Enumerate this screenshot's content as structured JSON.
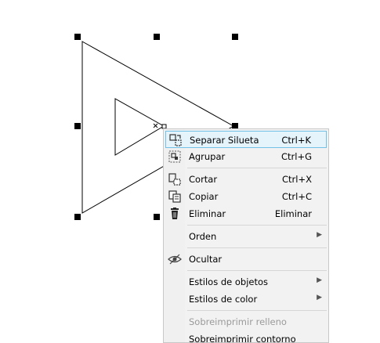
{
  "context_menu": {
    "items": [
      {
        "label": "Separar Silueta",
        "shortcut": "Ctrl+K"
      },
      {
        "label": "Agrupar",
        "shortcut": "Ctrl+G"
      },
      {
        "label": "Cortar",
        "shortcut": "Ctrl+X"
      },
      {
        "label": "Copiar",
        "shortcut": "Ctrl+C"
      },
      {
        "label": "Eliminar",
        "shortcut": "Eliminar"
      },
      {
        "label": "Orden",
        "submenu_arrow": "▶"
      },
      {
        "label": "Ocultar"
      },
      {
        "label": "Estilos de objetos",
        "submenu_arrow": "▶"
      },
      {
        "label": "Estilos de color",
        "submenu_arrow": "▶"
      },
      {
        "label": "Sobreimprimir relleno"
      },
      {
        "label": "Sobreimprimir contorno"
      }
    ],
    "icons": [
      "break-apart-icon",
      "group-icon",
      "cut-icon",
      "copy-icon",
      "trash-icon",
      "eye-hidden-icon"
    ]
  },
  "colors": {
    "highlight_bg": "#e5f3fb",
    "highlight_border": "#70c0e7",
    "disabled_text": "#9a9a9a"
  }
}
